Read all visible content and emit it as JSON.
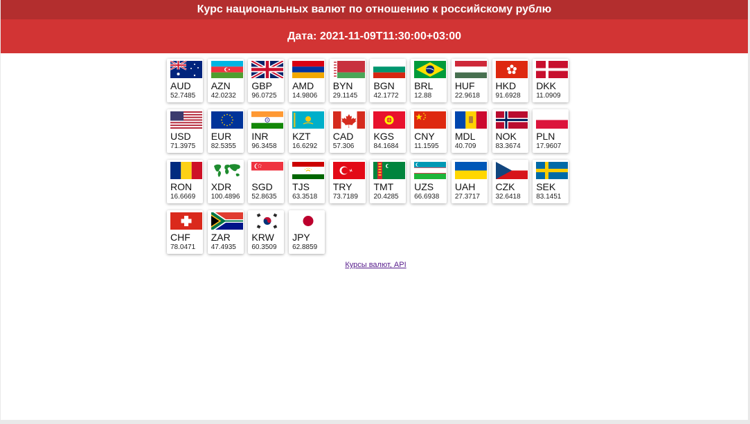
{
  "header": {
    "title": "Курс национальных валют по отношению к российскому рублю",
    "date": "Дата: 2021-11-09T11:30:00+03:00"
  },
  "currencies": [
    {
      "code": "AUD",
      "rate": "52.7485",
      "flag": "australia-flag-icon"
    },
    {
      "code": "AZN",
      "rate": "42.0232",
      "flag": "azerbaijan-flag-icon"
    },
    {
      "code": "GBP",
      "rate": "96.0725",
      "flag": "uk-flag-icon"
    },
    {
      "code": "AMD",
      "rate": "14.9806",
      "flag": "armenia-flag-icon"
    },
    {
      "code": "BYN",
      "rate": "29.1145",
      "flag": "belarus-flag-icon"
    },
    {
      "code": "BGN",
      "rate": "42.1772",
      "flag": "bulgaria-flag-icon"
    },
    {
      "code": "BRL",
      "rate": "12.88",
      "flag": "brazil-flag-icon"
    },
    {
      "code": "HUF",
      "rate": "22.9618",
      "flag": "hungary-flag-icon"
    },
    {
      "code": "HKD",
      "rate": "91.6928",
      "flag": "hongkong-flag-icon"
    },
    {
      "code": "DKK",
      "rate": "11.0909",
      "flag": "denmark-flag-icon"
    },
    {
      "code": "USD",
      "rate": "71.3975",
      "flag": "usa-flag-icon"
    },
    {
      "code": "EUR",
      "rate": "82.5355",
      "flag": "eu-flag-icon"
    },
    {
      "code": "INR",
      "rate": "96.3458",
      "flag": "india-flag-icon"
    },
    {
      "code": "KZT",
      "rate": "16.6292",
      "flag": "kazakhstan-flag-icon"
    },
    {
      "code": "CAD",
      "rate": "57.306",
      "flag": "canada-flag-icon"
    },
    {
      "code": "KGS",
      "rate": "84.1684",
      "flag": "kyrgyzstan-flag-icon"
    },
    {
      "code": "CNY",
      "rate": "11.1595",
      "flag": "china-flag-icon"
    },
    {
      "code": "MDL",
      "rate": "40.709",
      "flag": "moldova-flag-icon"
    },
    {
      "code": "NOK",
      "rate": "83.3674",
      "flag": "norway-flag-icon"
    },
    {
      "code": "PLN",
      "rate": "17.9607",
      "flag": "poland-flag-icon"
    },
    {
      "code": "RON",
      "rate": "16.6669",
      "flag": "romania-flag-icon"
    },
    {
      "code": "XDR",
      "rate": "100.4896",
      "flag": "world-map-flag-icon"
    },
    {
      "code": "SGD",
      "rate": "52.8635",
      "flag": "singapore-flag-icon"
    },
    {
      "code": "TJS",
      "rate": "63.3518",
      "flag": "tajikistan-flag-icon"
    },
    {
      "code": "TRY",
      "rate": "73.7189",
      "flag": "turkey-flag-icon"
    },
    {
      "code": "TMT",
      "rate": "20.4285",
      "flag": "turkmenistan-flag-icon"
    },
    {
      "code": "UZS",
      "rate": "66.6938",
      "flag": "uzbekistan-flag-icon"
    },
    {
      "code": "UAH",
      "rate": "27.3717",
      "flag": "ukraine-flag-icon"
    },
    {
      "code": "CZK",
      "rate": "32.6418",
      "flag": "czech-flag-icon"
    },
    {
      "code": "SEK",
      "rate": "83.1451",
      "flag": "sweden-flag-icon"
    },
    {
      "code": "CHF",
      "rate": "78.0471",
      "flag": "switzerland-flag-icon"
    },
    {
      "code": "ZAR",
      "rate": "47.4935",
      "flag": "south-africa-flag-icon"
    },
    {
      "code": "KRW",
      "rate": "60.3509",
      "flag": "south-korea-flag-icon"
    },
    {
      "code": "JPY",
      "rate": "62.8859",
      "flag": "japan-flag-icon"
    }
  ],
  "footer": {
    "link_text": "Курсы валют, API"
  },
  "colors": {
    "title_bar": "#b32e2e",
    "date_bar": "#d23434"
  }
}
